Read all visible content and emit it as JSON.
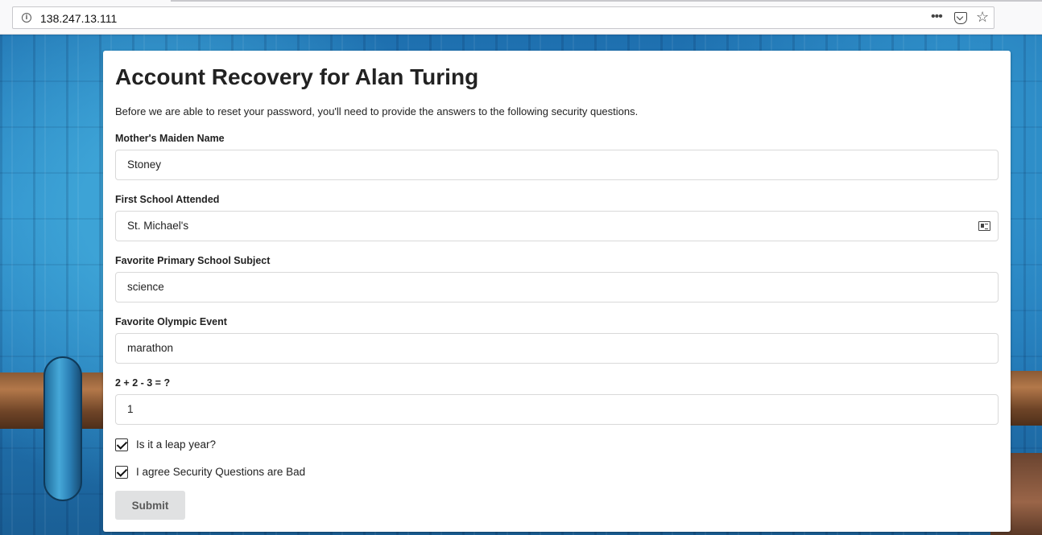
{
  "browser": {
    "url": "138.247.13.111"
  },
  "form": {
    "title": "Account Recovery for Alan Turing",
    "intro": "Before we are able to reset your password, you'll need to provide the answers to the following security questions.",
    "fields": [
      {
        "label": "Mother's Maiden Name",
        "value": "Stoney"
      },
      {
        "label": "First School Attended",
        "value": "St. Michael's"
      },
      {
        "label": "Favorite Primary School Subject",
        "value": "science"
      },
      {
        "label": "Favorite Olympic Event",
        "value": "marathon"
      },
      {
        "label": "2 + 2 - 3 = ?",
        "value": "1"
      }
    ],
    "checkboxes": [
      {
        "label": "Is it a leap year?",
        "checked": true
      },
      {
        "label": "I agree Security Questions are Bad",
        "checked": true
      }
    ],
    "submit_label": "Submit"
  },
  "icons": {
    "site_info": "info-icon",
    "page_actions": "more-icon",
    "pocket": "pocket-icon",
    "bookmark": "star-icon",
    "autofill": "contact-card-icon"
  }
}
